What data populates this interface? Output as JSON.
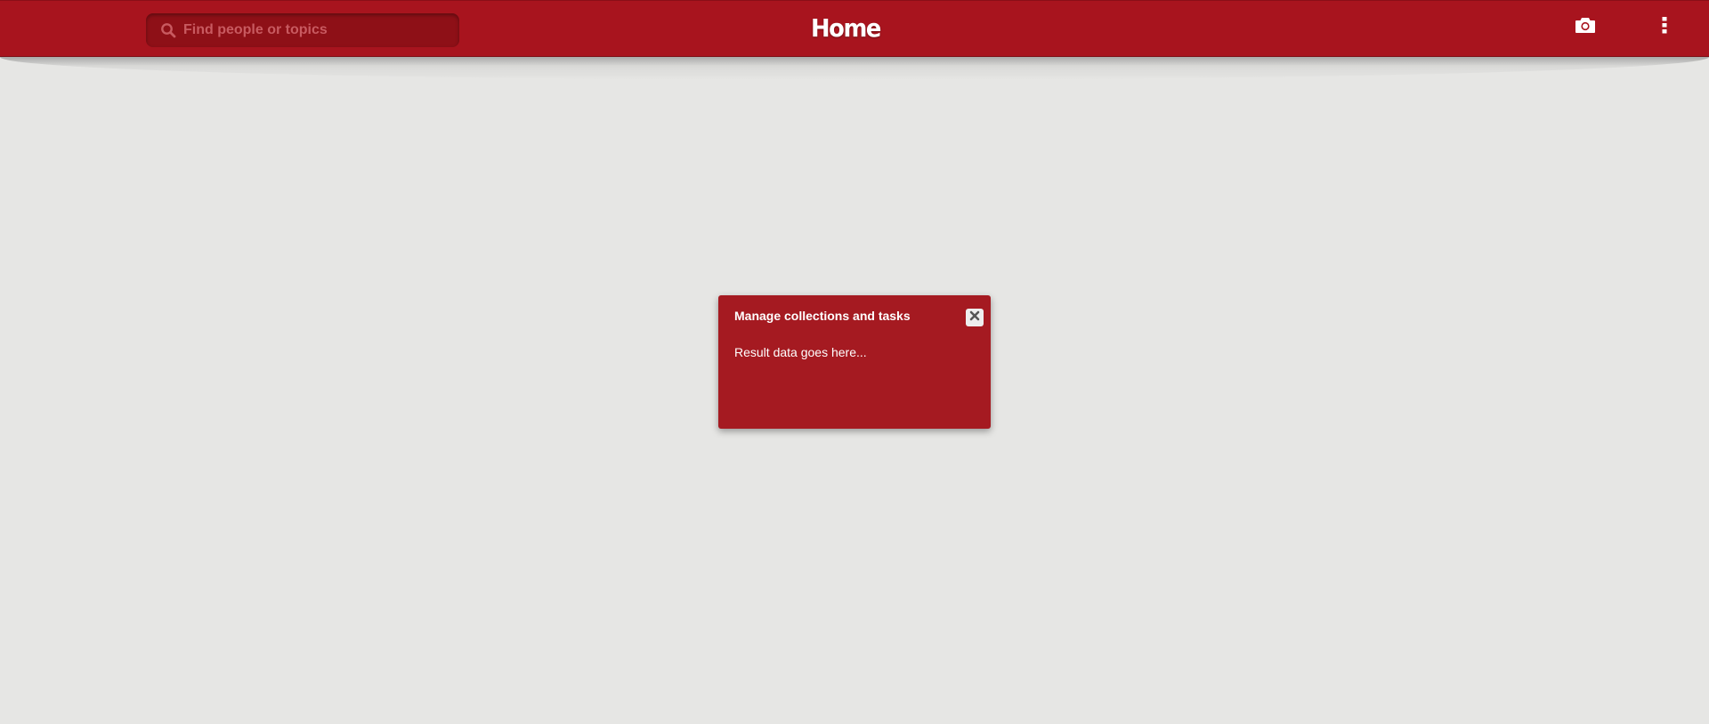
{
  "header": {
    "title": "Home",
    "search": {
      "placeholder": "Find people or topics",
      "value": ""
    },
    "icons": {
      "search": "search-icon",
      "camera": "camera-icon",
      "menu": "kebab-menu-icon"
    }
  },
  "modal": {
    "title": "Manage collections and tasks",
    "body": "Result data goes here...",
    "close_icon": "close-icon"
  },
  "colors": {
    "brand_red": "#a8141e",
    "search_bg": "#8e1017",
    "modal_bg": "#a51a21",
    "page_bg": "#e6e6e4"
  }
}
